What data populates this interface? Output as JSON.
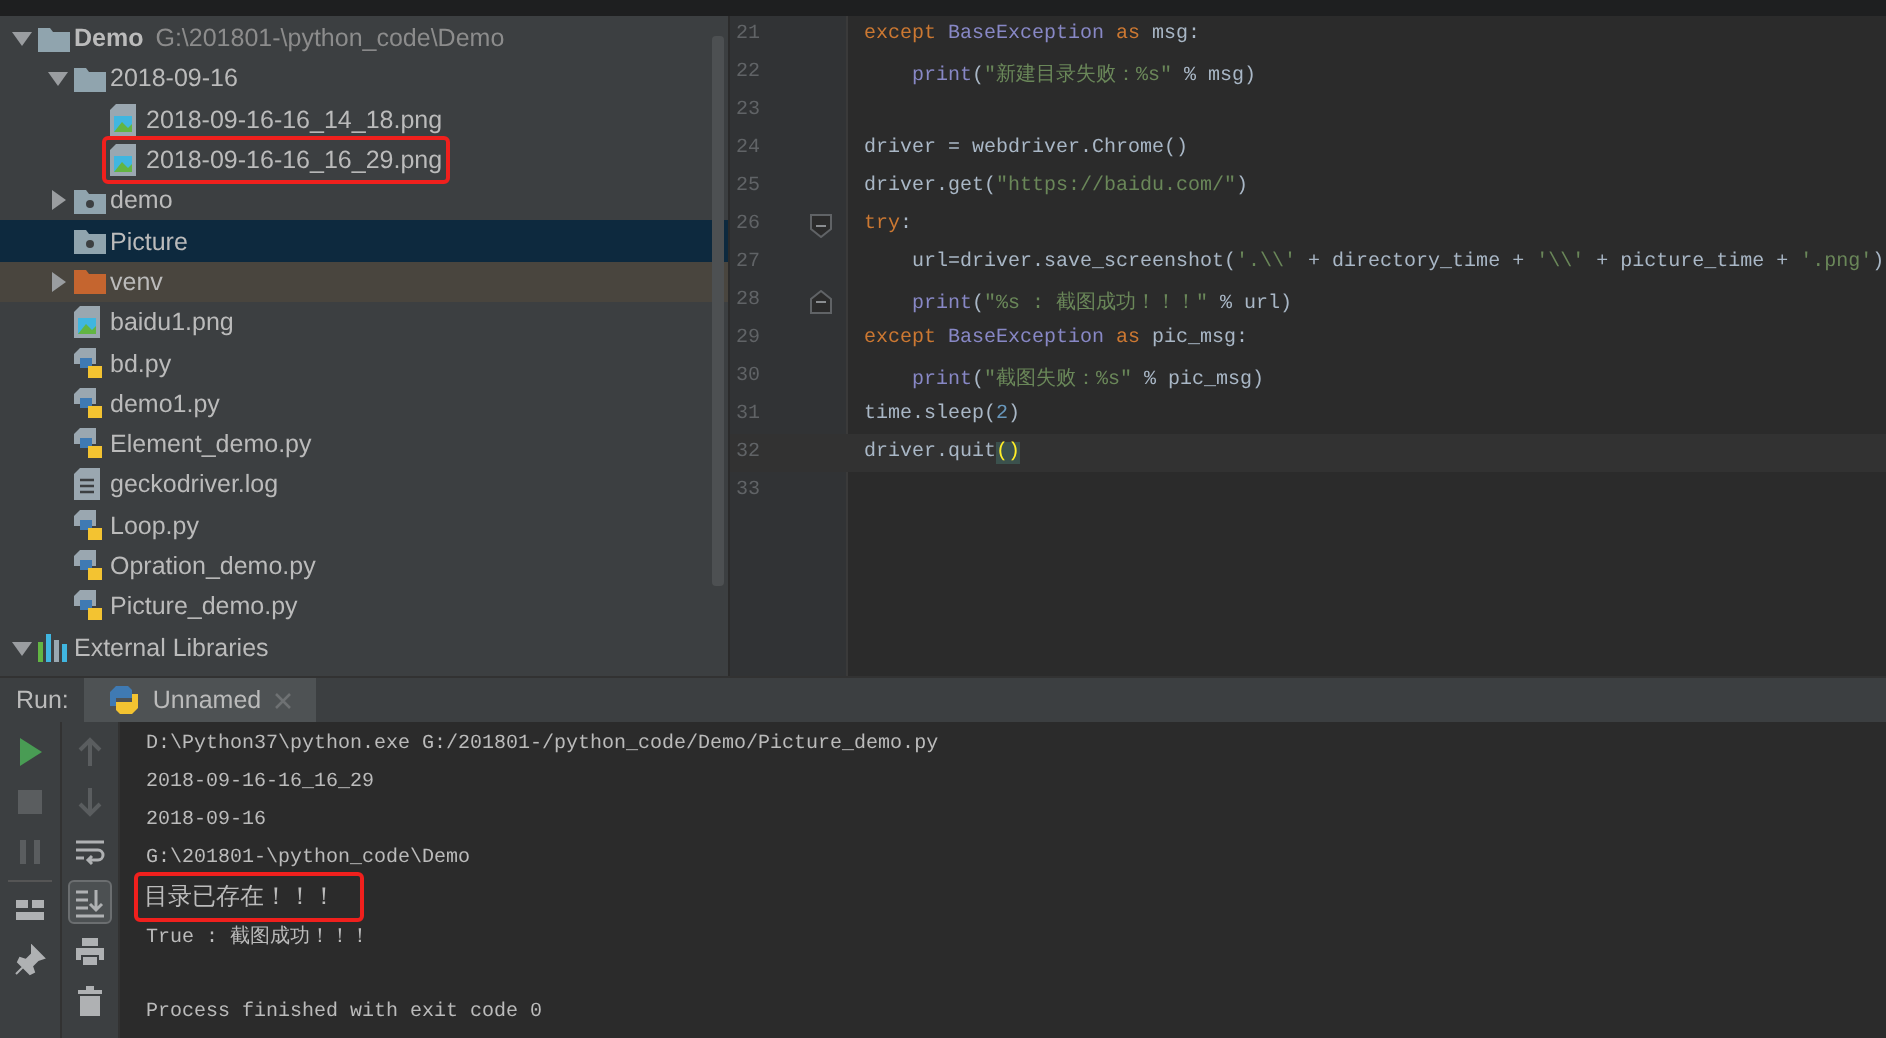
{
  "project_tree": {
    "items": [
      {
        "label": "Demo",
        "path": "G:\\201801-\\python_code\\Demo",
        "kind": "folder",
        "expanded": true,
        "selected": false,
        "children": [
          {
            "label": "2018-09-16",
            "kind": "folder",
            "expanded": true,
            "selected": false,
            "children": [
              {
                "label": "2018-09-16-16_14_18.png",
                "kind": "image",
                "selected": false,
                "annotated": false
              },
              {
                "label": "2018-09-16-16_16_29.png",
                "kind": "image",
                "selected": false,
                "annotated": true
              }
            ]
          },
          {
            "label": "demo",
            "kind": "package",
            "expanded": false,
            "selected": false
          },
          {
            "label": "Picture",
            "kind": "package",
            "selected": true
          },
          {
            "label": "venv",
            "kind": "excluded",
            "expanded": false,
            "selected": false
          },
          {
            "label": "baidu1.png",
            "kind": "image",
            "selected": false
          },
          {
            "label": "bd.py",
            "kind": "python",
            "selected": false
          },
          {
            "label": "demo1.py",
            "kind": "python",
            "selected": false
          },
          {
            "label": "Element_demo.py",
            "kind": "python",
            "selected": false
          },
          {
            "label": "geckodriver.log",
            "kind": "text",
            "selected": false
          },
          {
            "label": "Loop.py",
            "kind": "python",
            "selected": false
          },
          {
            "label": "Opration_demo.py",
            "kind": "python",
            "selected": false
          },
          {
            "label": "Picture_demo.py",
            "kind": "python",
            "selected": false
          }
        ]
      },
      {
        "label": "External Libraries",
        "kind": "library",
        "expanded": true,
        "selected": false
      }
    ]
  },
  "editor": {
    "lines": [
      {
        "number": "21",
        "tokens": [
          {
            "text": "except",
            "kind": "keyword"
          },
          {
            "text": " BaseException",
            "kind": "builtin"
          },
          {
            "text": " as",
            "kind": "keyword"
          },
          {
            "text": " msg:",
            "kind": "plain"
          }
        ]
      },
      {
        "number": "22",
        "tokens": [
          {
            "text": "    print",
            "kind": "builtin"
          },
          {
            "text": "(",
            "kind": "plain"
          },
          {
            "text": "\"新建目录失败：%s\"",
            "kind": "string"
          },
          {
            "text": " % msg)",
            "kind": "plain"
          }
        ]
      },
      {
        "number": "23"
      },
      {
        "number": "24",
        "tokens": [
          {
            "text": "driver = webdriver.Chrome()",
            "kind": "plain"
          }
        ]
      },
      {
        "number": "25",
        "tokens": [
          {
            "text": "driver.get(",
            "kind": "plain"
          },
          {
            "text": "\"https://baidu.com/\"",
            "kind": "string"
          },
          {
            "text": ")",
            "kind": "plain"
          }
        ]
      },
      {
        "number": "26",
        "fold_start": true,
        "tokens": [
          {
            "text": "try",
            "kind": "keyword"
          },
          {
            "text": ":",
            "kind": "plain"
          }
        ]
      },
      {
        "number": "27",
        "tokens": [
          {
            "text": "    url=driver.save_screenshot(",
            "kind": "plain"
          },
          {
            "text": "'.\\\\'",
            "kind": "string"
          },
          {
            "text": " + directory_time + ",
            "kind": "plain"
          },
          {
            "text": "'\\\\'",
            "kind": "string"
          },
          {
            "text": " + picture_time + ",
            "kind": "plain"
          },
          {
            "text": "'.png'",
            "kind": "string"
          },
          {
            "text": ")",
            "kind": "plain"
          }
        ]
      },
      {
        "number": "28",
        "fold_end": true,
        "tokens": [
          {
            "text": "    print",
            "kind": "builtin"
          },
          {
            "text": "(",
            "kind": "plain"
          },
          {
            "text": "\"%s : 截图成功！！！\"",
            "kind": "string"
          },
          {
            "text": " % url)",
            "kind": "plain"
          }
        ]
      },
      {
        "number": "29",
        "tokens": [
          {
            "text": "except",
            "kind": "keyword"
          },
          {
            "text": " BaseException",
            "kind": "builtin"
          },
          {
            "text": " as",
            "kind": "keyword"
          },
          {
            "text": " pic_msg:",
            "kind": "plain"
          }
        ]
      },
      {
        "number": "30",
        "tokens": [
          {
            "text": "    print",
            "kind": "builtin"
          },
          {
            "text": "(",
            "kind": "plain"
          },
          {
            "text": "\"截图失败：%s\"",
            "kind": "string"
          },
          {
            "text": " % pic_msg)",
            "kind": "plain"
          }
        ]
      },
      {
        "number": "31",
        "tokens": [
          {
            "text": "time.sleep(",
            "kind": "plain"
          },
          {
            "text": "2",
            "kind": "number"
          },
          {
            "text": ")",
            "kind": "plain"
          }
        ]
      },
      {
        "number": "32",
        "current": true,
        "tokens": [
          {
            "text": "driver.quit",
            "kind": "plain"
          },
          {
            "text": "()",
            "kind": "brace-match"
          }
        ]
      },
      {
        "number": "33"
      }
    ]
  },
  "run_panel": {
    "label": "Run:",
    "tab": {
      "label": "Unnamed",
      "selected": true
    },
    "tools_left": [
      {
        "kind": "run",
        "on": false
      },
      {
        "kind": "stop",
        "on": false
      },
      {
        "kind": "pause",
        "on": false
      },
      {
        "kind": "layout",
        "on": false
      },
      {
        "kind": "pin",
        "on": false
      }
    ],
    "tools_right": [
      {
        "kind": "up",
        "on": false
      },
      {
        "kind": "down",
        "on": false
      },
      {
        "kind": "wrap",
        "on": false
      },
      {
        "kind": "scroll-end",
        "on": true
      },
      {
        "kind": "print",
        "on": false
      },
      {
        "kind": "trash",
        "on": false
      }
    ],
    "console": [
      {
        "text": "D:\\Python37\\python.exe G:/201801-/python_code/Demo/Picture_demo.py",
        "annotated": false
      },
      {
        "text": "2018-09-16-16_16_29",
        "annotated": false
      },
      {
        "text": "2018-09-16",
        "annotated": false
      },
      {
        "text": "G:\\201801-\\python_code\\Demo",
        "annotated": false
      },
      {
        "text": "目录已存在！！！",
        "annotated": true
      },
      {
        "text": "True : 截图成功！！！",
        "annotated": false
      },
      {
        "text": "Process finished with exit code 0",
        "annotated": false,
        "blank_line_before": true
      }
    ]
  }
}
